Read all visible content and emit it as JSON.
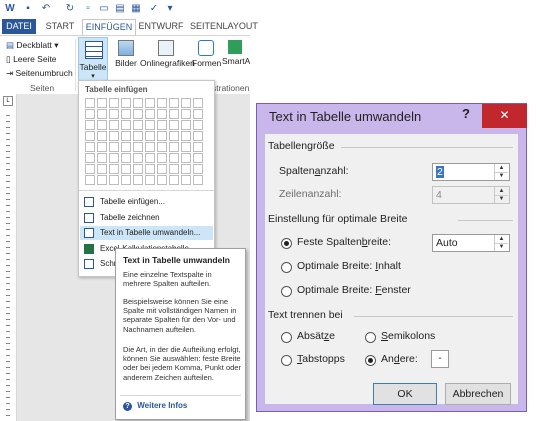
{
  "ribbon": {
    "tabs": [
      "DATEI",
      "START",
      "EINFÜGEN",
      "ENTWURF",
      "SEITENLAYOUT"
    ],
    "active_tab": "EINFÜGEN",
    "pages_group": {
      "cover": "Deckblatt",
      "blank": "Leere Seite",
      "break": "Seitenumbruch",
      "label": "Seiten"
    },
    "table_button": "Tabelle",
    "images_button": "Bilder",
    "online_button": "Onlinegrafiken",
    "shapes_button": "Formen",
    "smartart_button": "SmartAr",
    "illustrations_label": "strationen"
  },
  "table_menu": {
    "header": "Tabelle einfügen",
    "items": [
      {
        "label": "Tabelle einfügen...",
        "icon": "insert-table-icon"
      },
      {
        "label": "Tabelle zeichnen",
        "icon": "draw-table-icon"
      },
      {
        "label": "Text in Tabelle umwandeln...",
        "icon": "convert-text-icon"
      },
      {
        "label": "Excel-Kalkulationstabelle",
        "icon": "excel-icon"
      },
      {
        "label": "Schnelltabellen",
        "icon": "quick-tables-icon"
      }
    ]
  },
  "tooltip": {
    "title": "Text in Tabelle umwandeln",
    "p1": "Eine einzelne Textspalte in mehrere Spalten aufteilen.",
    "p2": "Beispielsweise können Sie eine Spalte mit vollständigen Namen in separate Spalten für den Vor- und Nachnamen aufteilen.",
    "p3": "Die Art, in der die Aufteilung erfolgt, können Sie auswählen: feste Breite oder bei jedem Komma, Punkt oder anderem Zeichen aufteilen.",
    "more": "Weitere Infos"
  },
  "dialog": {
    "title": "Text in Tabelle umwandeln",
    "help": "?",
    "close": "✕",
    "size_section": "Tabellengröße",
    "columns_label": "Spaltenanzahl:",
    "columns_value": "2",
    "rows_label": "Zeilenanzahl:",
    "rows_value": "4",
    "autofit_section": "Einstellung für optimale Breite",
    "fixed_label": "Feste Spaltenbreite:",
    "fixed_value": "Auto",
    "autofit_content": "Optimale Breite: Inhalt",
    "autofit_window": "Optimale Breite: Fenster",
    "separate_section": "Text trennen bei",
    "paragraphs": "Absätze",
    "semicolons": "Semikolons",
    "tabs": "Tabstopps",
    "other": "Andere:",
    "other_value": "-",
    "ok": "OK",
    "cancel": "Abbrechen"
  }
}
